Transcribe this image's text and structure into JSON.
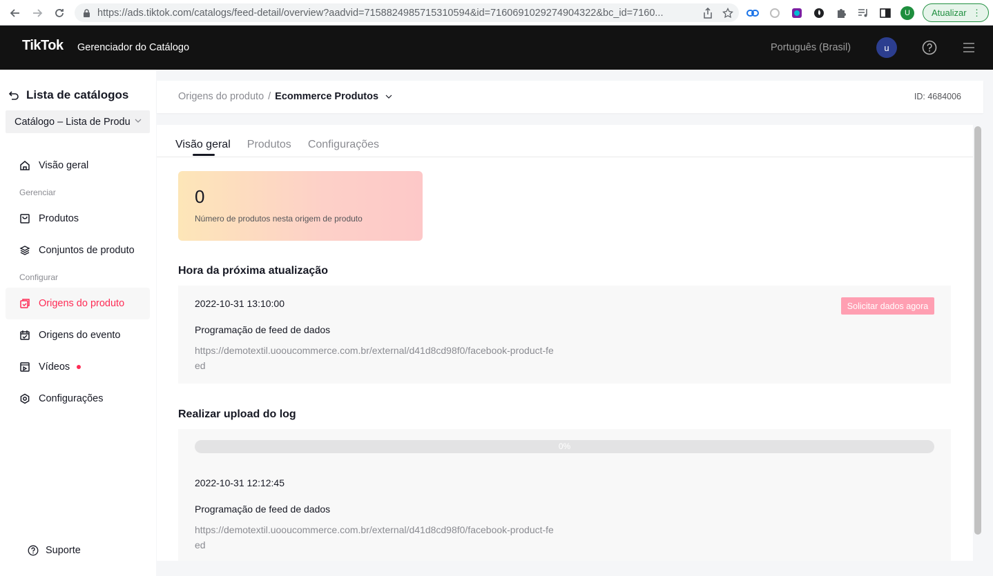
{
  "browser": {
    "url": "https://ads.tiktok.com/catalogs/feed-detail/overview?aadvid=7158824985715310594&id=7160691029274904322&bc_id=7160...",
    "profile_initial": "U",
    "update_label": "Atualizar"
  },
  "header": {
    "logo": "TikTok",
    "logo_sub": "Gerenciador do Catálogo",
    "language": "Português (Brasil)",
    "avatar_initial": "u"
  },
  "sidebar": {
    "back_label": "Lista de catálogos",
    "catalog_select": "Catálogo – Lista de Produ",
    "items": [
      {
        "label": "Visão geral"
      },
      {
        "label": "Produtos"
      },
      {
        "label": "Conjuntos de produto"
      },
      {
        "label": "Origens do produto"
      },
      {
        "label": "Origens do evento"
      },
      {
        "label": "Vídeos"
      },
      {
        "label": "Configurações"
      }
    ],
    "sections": {
      "manage": "Gerenciar",
      "configure": "Configurar"
    },
    "support": "Suporte"
  },
  "breadcrumb": {
    "parent": "Origens do produto",
    "separator": "/",
    "current": "Ecommerce Produtos",
    "id_label": "ID: 4684006"
  },
  "tabs": [
    {
      "label": "Visão geral"
    },
    {
      "label": "Produtos"
    },
    {
      "label": "Configurações"
    }
  ],
  "stat": {
    "value": "0",
    "label": "Número de produtos nesta origem de produto"
  },
  "next_update": {
    "title": "Hora da próxima atualização",
    "date": "2022-10-31 13:10:00",
    "button": "Solicitar dados agora",
    "schedule_label": "Programação de feed de dados",
    "url": "https://demotextil.uooucommerce.com.br/external/d41d8cd98f0/facebook-product-feed"
  },
  "upload_log": {
    "title": "Realizar upload do log",
    "progress_text": "0%",
    "progress_value": 0,
    "date": "2022-10-31 12:12:45",
    "schedule_label": "Programação de feed de dados",
    "url": "https://demotextil.uooucommerce.com.br/external/d41d8cd98f0/facebook-product-feed"
  },
  "colors": {
    "accent": "#fe2c55",
    "header_bg": "#121212"
  }
}
